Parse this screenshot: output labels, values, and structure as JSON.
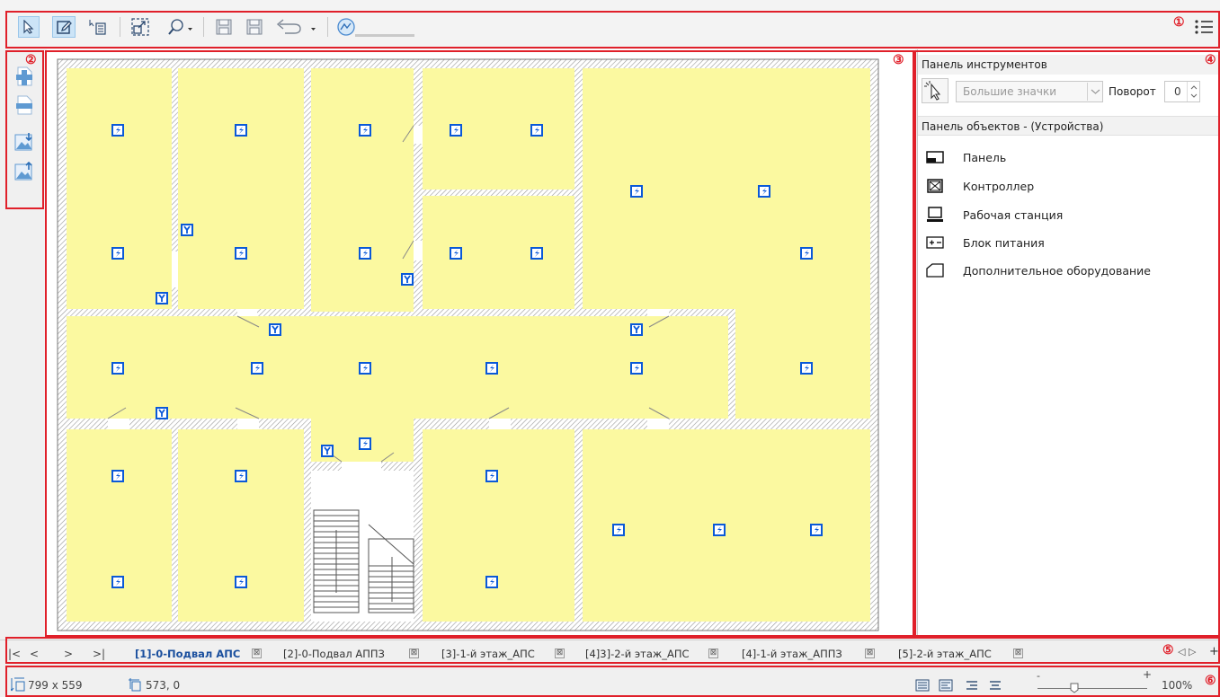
{
  "colors": {
    "accent": "#e0202a",
    "room_fill": "#fbf9a0",
    "device_blue": "#0a59d8",
    "active_tab": "#1a4f9e"
  },
  "annotations": [
    "①",
    "②",
    "③",
    "④",
    "⑤",
    "⑥"
  ],
  "toolbar": {
    "icons": [
      "select-arrow-icon",
      "edit-icon",
      "properties-icon",
      "zoom-frame-icon",
      "search-zoom-icon",
      "save-icon",
      "save-as-icon",
      "undo-icon",
      "zoom-slider-icon",
      "menu-icon"
    ]
  },
  "left_toolbar": {
    "icons": [
      "add-floor-icon",
      "remove-floor-icon",
      "import-image-icon",
      "export-image-icon"
    ]
  },
  "tools_panel": {
    "title": "Панель инструментов",
    "icon_size_value": "Большие значки",
    "rotation_label": "Поворот",
    "rotation_value": "0"
  },
  "objects_panel": {
    "title": "Панель объектов - (Устройства)",
    "items": [
      {
        "label": "Панель",
        "icon": "panel-icon"
      },
      {
        "label": "Контроллер",
        "icon": "controller-icon"
      },
      {
        "label": "Рабочая станция",
        "icon": "workstation-icon"
      },
      {
        "label": "Блок питания",
        "icon": "power-supply-icon"
      },
      {
        "label": "Дополнительное оборудование",
        "icon": "extra-equipment-icon"
      }
    ]
  },
  "tabs": {
    "items": [
      {
        "label": "[1]-0-Подвал АПС",
        "active": true
      },
      {
        "label": "[2]-0-Подвал АППЗ",
        "active": false
      },
      {
        "label": "[3]-1-й этаж_АПС",
        "active": false
      },
      {
        "label": "[4]3]-2-й этаж_АПС",
        "active": false
      },
      {
        "label": "[4]-1-й этаж_АППЗ",
        "active": false
      },
      {
        "label": "[5]-2-й этаж_АПС",
        "active": false
      }
    ],
    "close_glyph": "⊠",
    "nav": [
      "|<",
      "<",
      ">",
      ">|"
    ],
    "scroll_glyphs": "◁ ▷",
    "add_glyph": "+"
  },
  "status": {
    "size": "799 x 559",
    "cursor": "573, 0",
    "zoom": "100%",
    "zoom_minus": "-",
    "zoom_plus": "+"
  }
}
